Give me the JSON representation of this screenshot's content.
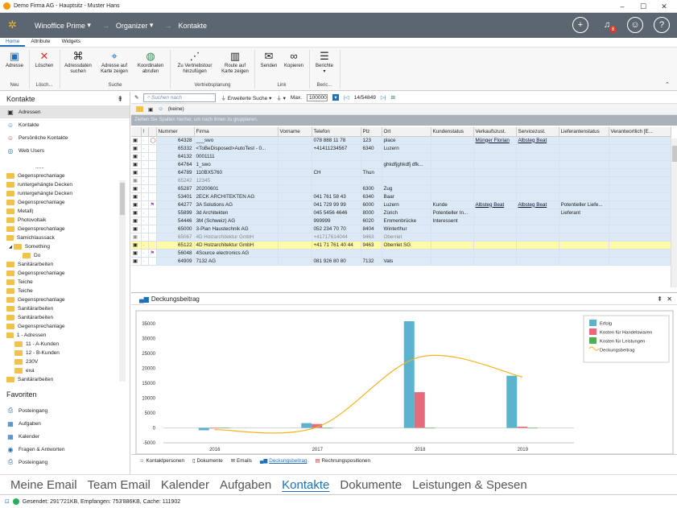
{
  "window": {
    "title": "Demo Firma AG - Hauptsitz - Muster Hans",
    "min": "–",
    "max": "☐",
    "close": "✕"
  },
  "appbar": {
    "crumbs": [
      "Winoffice Prime",
      "Organizer",
      "Kontakte"
    ],
    "badge": "8"
  },
  "ribbon_tabs": [
    "Home",
    "Attribute",
    "Widgets"
  ],
  "ribbon": {
    "buttons": [
      "Adresse",
      "Löschen",
      "Adressdaten suchen",
      "Adresse auf Karte zeigen",
      "Koordinaten abrufen",
      "Zu Vertriebstour hinzufügen",
      "Route auf Karte zeigen",
      "Senden",
      "Kopieren",
      "Berichte"
    ],
    "groups": [
      "Neu",
      "Lösch...",
      "Suche",
      "Vertriebsplanung",
      "Link",
      "Beric..."
    ]
  },
  "left": {
    "title": "Kontakte",
    "pin": "⇞",
    "items": [
      "Adressen",
      "Kontakte",
      "Persönliche Kontakte",
      "Web Users"
    ],
    "tree": [
      {
        "label": "......",
        "lvl": 0,
        "folder": false
      },
      {
        "label": "Gegensprechanlage",
        "lvl": 0,
        "folder": true
      },
      {
        "label": "runtergehängte Decken",
        "lvl": 0,
        "folder": true
      },
      {
        "label": "runtergehängte Decken",
        "lvl": 0,
        "folder": true
      },
      {
        "label": "Gegensprechanlage",
        "lvl": 0,
        "folder": true
      },
      {
        "label": "Metall)",
        "lvl": 0,
        "folder": true
      },
      {
        "label": "Photovoltaik",
        "lvl": 0,
        "folder": true
      },
      {
        "label": "Gegensprechanlage",
        "lvl": 0,
        "folder": true
      },
      {
        "label": "Samichlaussack",
        "lvl": 0,
        "folder": true,
        "exp": true
      },
      {
        "label": "Something",
        "lvl": 1,
        "folder": true,
        "exp": true
      },
      {
        "label": "Do",
        "lvl": 2,
        "folder": true
      },
      {
        "label": "Sanitärarbeiten",
        "lvl": 0,
        "folder": true
      },
      {
        "label": "Gegensprechanlage",
        "lvl": 0,
        "folder": true
      },
      {
        "label": "Teiche",
        "lvl": 0,
        "folder": true
      },
      {
        "label": "Teiche",
        "lvl": 0,
        "folder": true
      },
      {
        "label": "Gegensprechanlage",
        "lvl": 0,
        "folder": true
      },
      {
        "label": "Sanitärarbeiten",
        "lvl": 0,
        "folder": true
      },
      {
        "label": "Sanitärarbeiten",
        "lvl": 0,
        "folder": true
      },
      {
        "label": "Gegensprechanlage",
        "lvl": 0,
        "folder": true
      },
      {
        "label": "1 - Adressen",
        "lvl": 0,
        "folder": true,
        "exp": true
      },
      {
        "label": "11 - A-Kunden",
        "lvl": 1,
        "folder": true
      },
      {
        "label": "12 - B-Kunden",
        "lvl": 1,
        "folder": true
      },
      {
        "label": "230V",
        "lvl": 1,
        "folder": true
      },
      {
        "label": "exa",
        "lvl": 1,
        "folder": true
      },
      {
        "label": "Sanitärarbeiten",
        "lvl": 0,
        "folder": true
      }
    ],
    "fav_title": "Favoriten",
    "favs": [
      "Posteingang",
      "Aufgaben",
      "Kalender",
      "Fragen & Antworten",
      "Posteingang"
    ]
  },
  "toolbar": {
    "search_placeholder": "Suchen nach",
    "ext_search": "Erweiterte Suche",
    "max_label": "Max.",
    "max_value": "100000",
    "count": "14/54849",
    "filter": "(keine)"
  },
  "grid": {
    "group_hint": "Ziehen Sie Spalten hierher, um nach ihnen zu gruppieren.",
    "headers": [
      "",
      "!",
      "",
      "Nummer",
      "Firma",
      "Vorname",
      "Telefon",
      "Plz",
      "Ort",
      "Kundenstatus",
      "Verkaufszust.",
      "Servicezust.",
      "Lieferantenstatus",
      "Verantwortlich [E..."
    ],
    "rows": [
      [
        "",
        "",
        "◯",
        "64328",
        "___swo",
        "",
        "078 888 11 78",
        "123",
        "place",
        "",
        "Münger Florian",
        "Albsteg Beat",
        "",
        ""
      ],
      [
        "",
        "",
        "",
        "65332",
        "<ToBeDisposed>AutoTest - 0...",
        "",
        "+41411234567",
        "6340",
        "Luzern",
        "",
        "",
        "",
        "",
        ""
      ],
      [
        "",
        "",
        "",
        "64132",
        "0001111",
        "",
        "",
        "",
        "",
        "",
        "",
        "",
        "",
        ""
      ],
      [
        "",
        "",
        "",
        "64764",
        "1_swo",
        "",
        "",
        "",
        "ghkdfjghkdfj dfk...",
        "",
        "",
        "",
        "",
        ""
      ],
      [
        "",
        "",
        "",
        "64789",
        "110BX5760",
        "",
        "CH",
        "Thun",
        "",
        "",
        "",
        "",
        "",
        ""
      ],
      [
        "",
        "",
        "",
        "65242",
        "12345",
        "",
        "",
        "",
        "",
        "",
        "",
        "",
        "",
        ""
      ],
      [
        "",
        "",
        "",
        "65287",
        "20200601",
        "",
        "",
        "6300",
        "Zug",
        "",
        "",
        "",
        "",
        ""
      ],
      [
        "",
        "",
        "",
        "53401",
        "2ECK ARCHITEKTEN AG",
        "",
        "041 761 58 43",
        "6340",
        "Baar",
        "",
        "",
        "",
        "",
        ""
      ],
      [
        "",
        "",
        "⚑",
        "64277",
        "3A Solutions AG",
        "",
        "041 729 99 99",
        "6000",
        "Luzern",
        "Kunde",
        "Albsteg Beat",
        "Albsteg Beat",
        "Potentieller Liefe...",
        ""
      ],
      [
        "",
        "",
        "",
        "55899",
        "3d Architekten",
        "",
        "045 5456 4646",
        "8000",
        "Zürich",
        "Potentieller In...",
        "",
        "",
        "Lieferant",
        ""
      ],
      [
        "",
        "",
        "",
        "54446",
        "3M (Schweiz) AG",
        "",
        "999999",
        "6020",
        "Emmenbrücke",
        "Interessent",
        "",
        "",
        "",
        ""
      ],
      [
        "",
        "",
        "",
        "65000",
        "3-Plan Haustechnik AG",
        "",
        "052 234 70 70",
        "8404",
        "Winterthur",
        "",
        "",
        "",
        "",
        ""
      ],
      [
        "",
        "",
        "",
        "65067",
        "4D Holzarchitektur GmbH",
        "",
        "+41717614044",
        "9463",
        "Oberriet",
        "",
        "",
        "",
        "",
        ""
      ],
      [
        "",
        "",
        "",
        "65122",
        "4D Holzarchitektur GmbH",
        "",
        "+41 71 761 40 44",
        "9463",
        "Oberriet SG",
        "",
        "",
        "",
        "",
        ""
      ],
      [
        "",
        "",
        "⚑",
        "56048",
        "4Source electronics AG",
        "",
        "",
        "",
        "",
        "",
        "",
        "",
        "",
        ""
      ],
      [
        "",
        "",
        "",
        "64909",
        "7132 AG",
        "",
        "081 926 80 80",
        "7132",
        "Vals",
        "",
        "",
        "",
        "",
        ""
      ]
    ]
  },
  "chart_panel": {
    "title": "Deckungsbeitrag",
    "pin": "⇞",
    "close": "✕"
  },
  "chart_data": {
    "type": "bar",
    "categories": [
      "2016",
      "2017",
      "2018",
      "2019"
    ],
    "series": [
      {
        "name": "Erfolg",
        "values": [
          -800,
          1600,
          35800,
          17500
        ],
        "color": "#5bb3d0"
      },
      {
        "name": "Kosten für Handelswaren",
        "values": [
          -200,
          1300,
          12000,
          400
        ],
        "color": "#e56a7a"
      },
      {
        "name": "Kosten für Leistungen",
        "values": [
          0,
          0,
          0,
          0
        ],
        "color": "#4caf50"
      },
      {
        "name": "Deckungsbeitrag",
        "type": "line",
        "values": [
          -600,
          300,
          23800,
          17100
        ],
        "color": "#f6b31f"
      }
    ],
    "yticks": [
      "35000",
      "30000",
      "25000",
      "20000",
      "15000",
      "10000",
      "5000",
      "0",
      "-5000"
    ],
    "ylim": [
      -5000,
      35000
    ],
    "legend": "top-right"
  },
  "bottom_tabs": [
    "Kontaktpersonen",
    "Dokumente",
    "Emails",
    "Deckungsbeitrag",
    "Rechnungspositionen"
  ],
  "nav": [
    "Meine Email",
    "Team Email",
    "Kalender",
    "Aufgaben",
    "Kontakte",
    "Dokumente",
    "Leistungen & Spesen"
  ],
  "status": "Gesendet: 291'721KB, Empfangen: 753'886KB, Cache: 111902"
}
